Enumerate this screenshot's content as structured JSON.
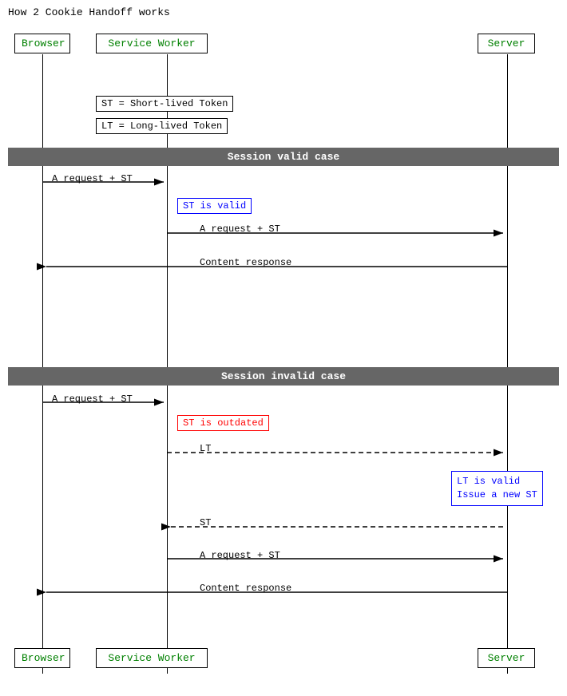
{
  "title": "How 2 Cookie Handoff works",
  "actors": {
    "browser": "Browser",
    "serviceWorker": "Service Worker",
    "server": "Server"
  },
  "notes": {
    "st": "ST = Short-lived Token",
    "lt": "LT = Long-lived Token"
  },
  "sections": {
    "valid": "Session valid case",
    "invalid": "Session invalid case"
  },
  "messages": {
    "requestST1": "A request + ST",
    "stValid": "ST is valid",
    "requestST2": "A request + ST",
    "contentResponse1": "Content response",
    "requestST3": "A request + ST",
    "stOutdated": "ST is outdated",
    "ltSend": "LT",
    "ltValid": "LT is valid\nIssue a new ST",
    "stReturn": "ST",
    "requestST4": "A request + ST",
    "contentResponse2": "Content response"
  }
}
